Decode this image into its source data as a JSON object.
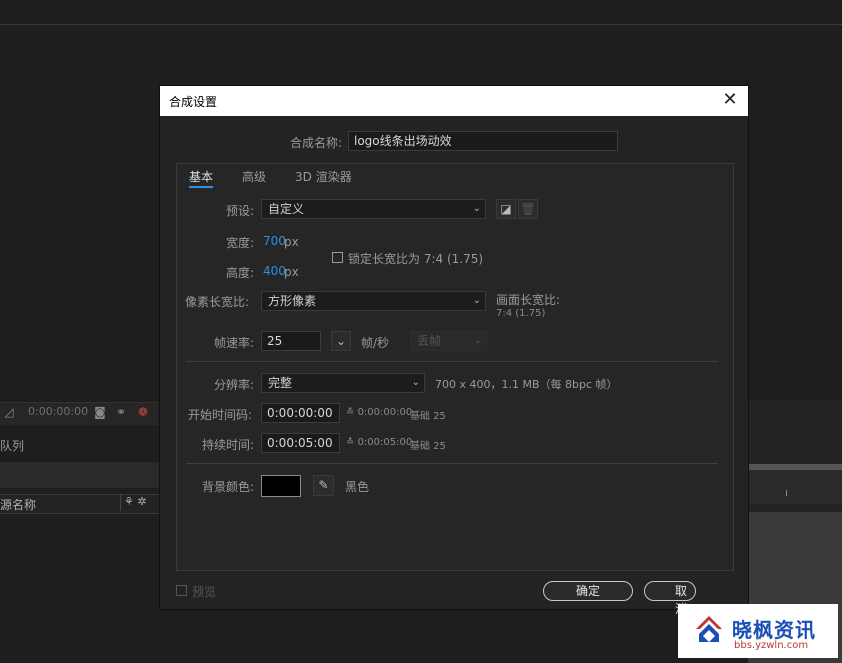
{
  "background": {
    "timecode": "0:00:00:00",
    "queue_label": "队列",
    "source_name_label": "源名称"
  },
  "dialog": {
    "title": "合成设置",
    "comp_name_label": "合成名称:",
    "comp_name_value": "logo线条出场动效",
    "tabs": [
      {
        "label": "基本",
        "active": true
      },
      {
        "label": "高级",
        "active": false
      },
      {
        "label": "3D 渲染器",
        "active": false
      }
    ],
    "preset": {
      "label": "预设:",
      "value": "自定义"
    },
    "width": {
      "label": "宽度:",
      "value": "700",
      "unit": "px"
    },
    "height": {
      "label": "高度:",
      "value": "400",
      "unit": "px"
    },
    "lock_aspect": {
      "label": "锁定长宽比为 7:4 (1.75)",
      "checked": false
    },
    "pixel_aspect": {
      "label": "像素长宽比:",
      "value": "方形像素"
    },
    "frame_aspect": {
      "label": "画面长宽比:",
      "value": "7:4 (1.75)"
    },
    "frame_rate": {
      "label": "帧速率:",
      "value": "25",
      "unit": "帧/秒",
      "drop_frame": "丢帧"
    },
    "resolution": {
      "label": "分辨率:",
      "value": "完整",
      "info": "700 x 400，1.1 MB（每 8bpc 帧）"
    },
    "start_timecode": {
      "label": "开始时间码:",
      "value": "0:00:00:00",
      "note": "0:00:00:00",
      "base": "基础 25"
    },
    "duration": {
      "label": "持续时间:",
      "value": "0:00:05:00",
      "note": "0:00:05:00",
      "base": "基础 25"
    },
    "bg_color": {
      "label": "背景颜色:",
      "color": "#000000",
      "name": "黑色"
    },
    "preview_label": "预览",
    "ok_label": "确定",
    "cancel_label": "取消"
  },
  "watermark": {
    "title": "晓枫资讯",
    "url": "bbs.yzwln.com"
  }
}
